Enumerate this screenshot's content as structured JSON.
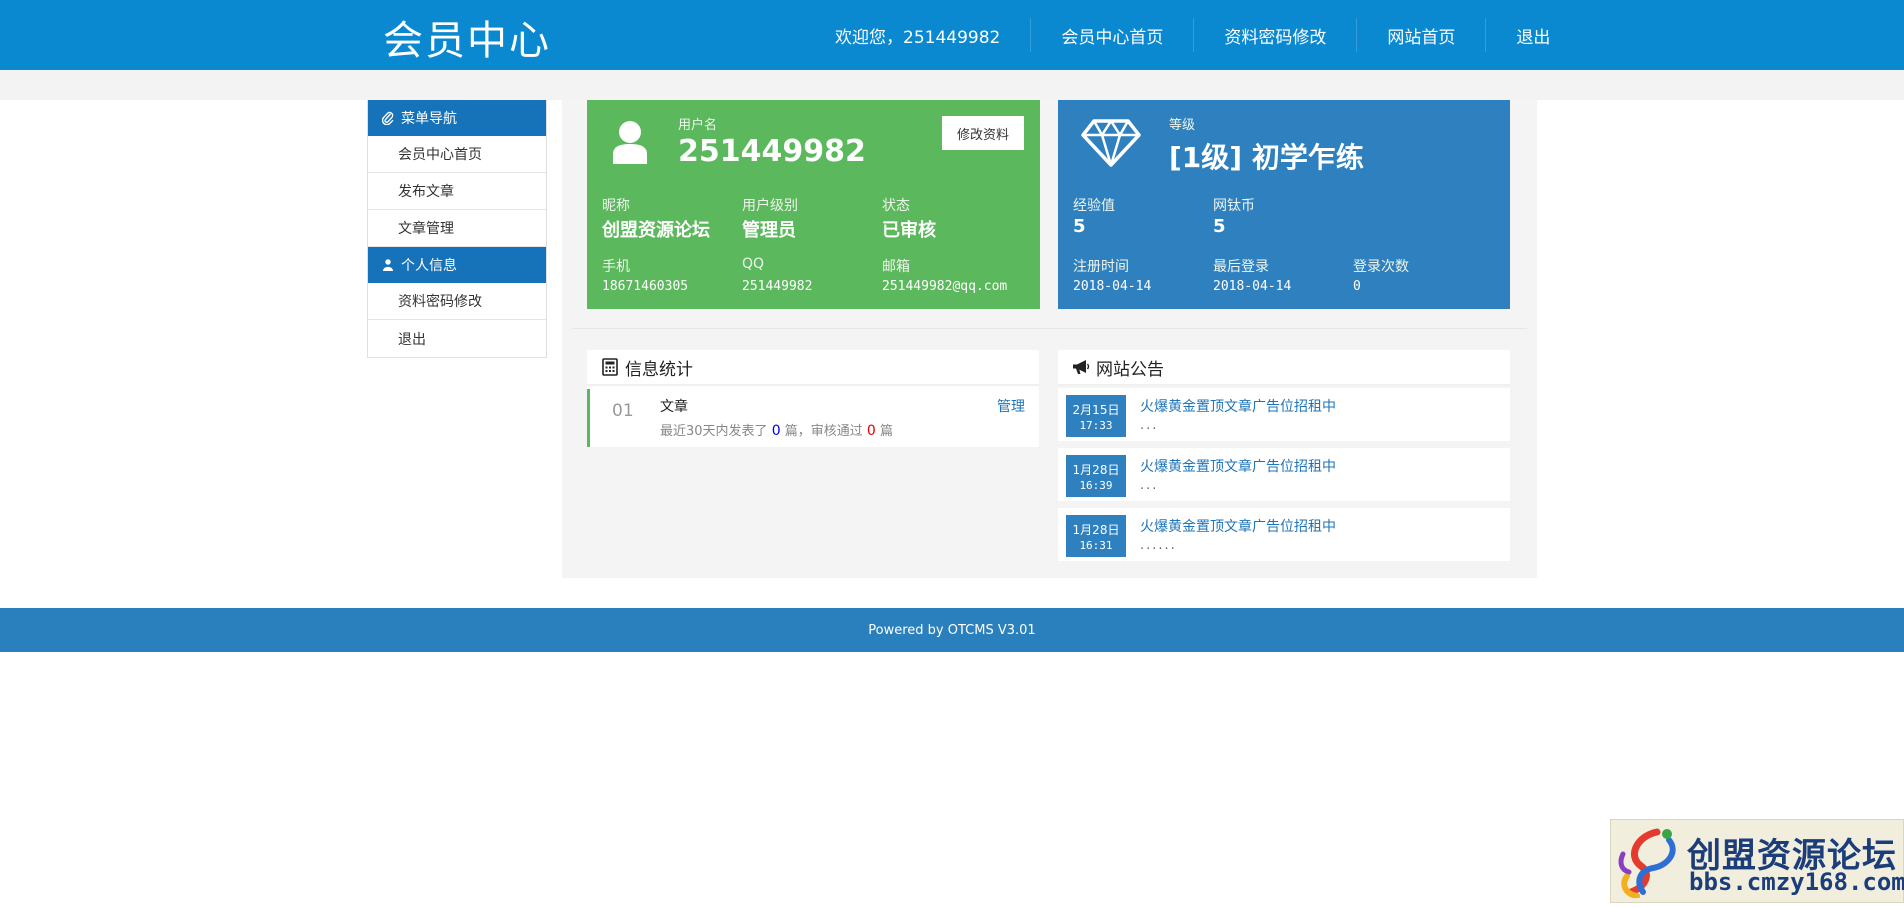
{
  "header": {
    "title": "会员中心",
    "welcome": "欢迎您，251449982",
    "nav": [
      "会员中心首页",
      "资料密码修改",
      "网站首页",
      "退出"
    ]
  },
  "sidebar": {
    "section1": {
      "title": "菜单导航",
      "icon": "paperclip-icon",
      "items": [
        "会员中心首页",
        "发布文章",
        "文章管理"
      ]
    },
    "section2": {
      "title": "个人信息",
      "icon": "user-icon",
      "items": [
        "资料密码修改",
        "退出"
      ]
    }
  },
  "user_card": {
    "username_label": "用户名",
    "username": "251449982",
    "edit_button": "修改资料",
    "nickname_label": "昵称",
    "nickname": "创盟资源论坛",
    "level_label": "用户级别",
    "level": "管理员",
    "status_label": "状态",
    "status": "已审核",
    "phone_label": "手机",
    "phone": "18671460305",
    "qq_label": "QQ",
    "qq": "251449982",
    "email_label": "邮箱",
    "email": "251449982@qq.com",
    "color": "#5cb85c"
  },
  "grade_card": {
    "grade_label": "等级",
    "grade": "[1级] 初学乍练",
    "exp_label": "经验值",
    "exp": "5",
    "coins_label": "网钛币",
    "coins": "5",
    "reg_label": "注册时间",
    "reg_time": "2018-04-14",
    "last_label": "最后登录",
    "last_login": "2018-04-14",
    "count_label": "登录次数",
    "login_count": "0",
    "color": "#2f80bf"
  },
  "stats": {
    "title": "信息统计",
    "icon": "calculator-icon",
    "rows": [
      {
        "num": "01",
        "name": "文章",
        "desc_prefix": "最近30天内发表了",
        "published": "0",
        "desc_mid": "篇，审核通过",
        "approved": "0",
        "desc_suffix": "篇",
        "action": "管理"
      }
    ]
  },
  "notices": {
    "title": "网站公告",
    "icon": "megaphone-icon",
    "items": [
      {
        "date": "2月15日",
        "time": "17:33",
        "title": "火爆黄金置顶文章广告位招租中",
        "sub": "..."
      },
      {
        "date": "1月28日",
        "time": "16:39",
        "title": "火爆黄金置顶文章广告位招租中",
        "sub": "..."
      },
      {
        "date": "1月28日",
        "time": "16:31",
        "title": "火爆黄金置顶文章广告位招租中",
        "sub": "......"
      }
    ]
  },
  "footer": {
    "text": "Powered by OTCMS V3.01"
  },
  "watermark": {
    "title": "创盟资源论坛",
    "url": "bbs.cmzy168.com"
  }
}
